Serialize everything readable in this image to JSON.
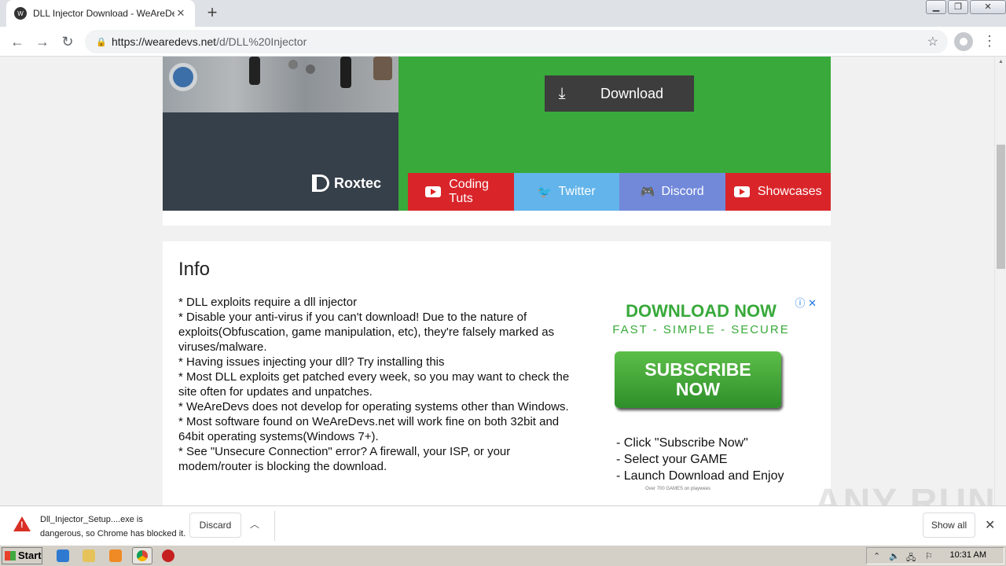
{
  "browser": {
    "tab_title": "DLL Injector Download - WeAreDevs",
    "new_tab": "+",
    "url_host": "https://wearedevs.net",
    "url_path": "/d/DLL%20Injector"
  },
  "hero": {
    "brand": "Roxtec",
    "download_label": "Download"
  },
  "socials": [
    {
      "label": "Coding Tuts",
      "icon": "youtube-icon",
      "color": "#d9252a"
    },
    {
      "label": "Twitter",
      "icon": "twitter-icon",
      "color": "#62b4ea"
    },
    {
      "label": "Discord",
      "icon": "discord-icon",
      "color": "#7289da"
    },
    {
      "label": "Showcases",
      "icon": "youtube-icon",
      "color": "#d9252a"
    }
  ],
  "info": {
    "title": "Info",
    "lines": [
      "* DLL exploits require a dll injector",
      "* Disable your anti-virus if you can't download! Due to the nature of exploits(Obfuscation, game manipulation, etc), they're falsely marked as viruses/malware.",
      "* Having issues injecting your dll? Try installing this",
      "* Most DLL exploits get patched every week, so you may want to check the site often for updates and unpatches.",
      "* WeAreDevs does not develop for operating systems other than Windows.",
      "* Most software found on WeAreDevs.net will work fine on both 32bit and 64bit operating systems(Windows 7+).",
      "* See \"Unsecure Connection\" error? A firewall, your ISP, or your modem/router is blocking the download."
    ]
  },
  "ad": {
    "headline": "DOWNLOAD NOW",
    "subline": "FAST - SIMPLE - SECURE",
    "button": "SUBSCRIBE NOW",
    "steps": [
      "- Click \"Subscribe Now\"",
      "- Select your GAME",
      "- Launch Download and Enjoy"
    ],
    "footnote": "Over 700 GAMES on playwees"
  },
  "download_bar": {
    "filename": "Dll_Injector_Setup....exe is",
    "message": "dangerous, so Chrome has blocked it.",
    "discard": "Discard",
    "show_all": "Show all"
  },
  "watermark": "ANY RUN",
  "taskbar": {
    "start": "Start",
    "clock": "10:31 AM"
  },
  "colors": {
    "hero_green": "#38a93a",
    "dark_panel": "#36404a",
    "danger": "#d93025"
  }
}
